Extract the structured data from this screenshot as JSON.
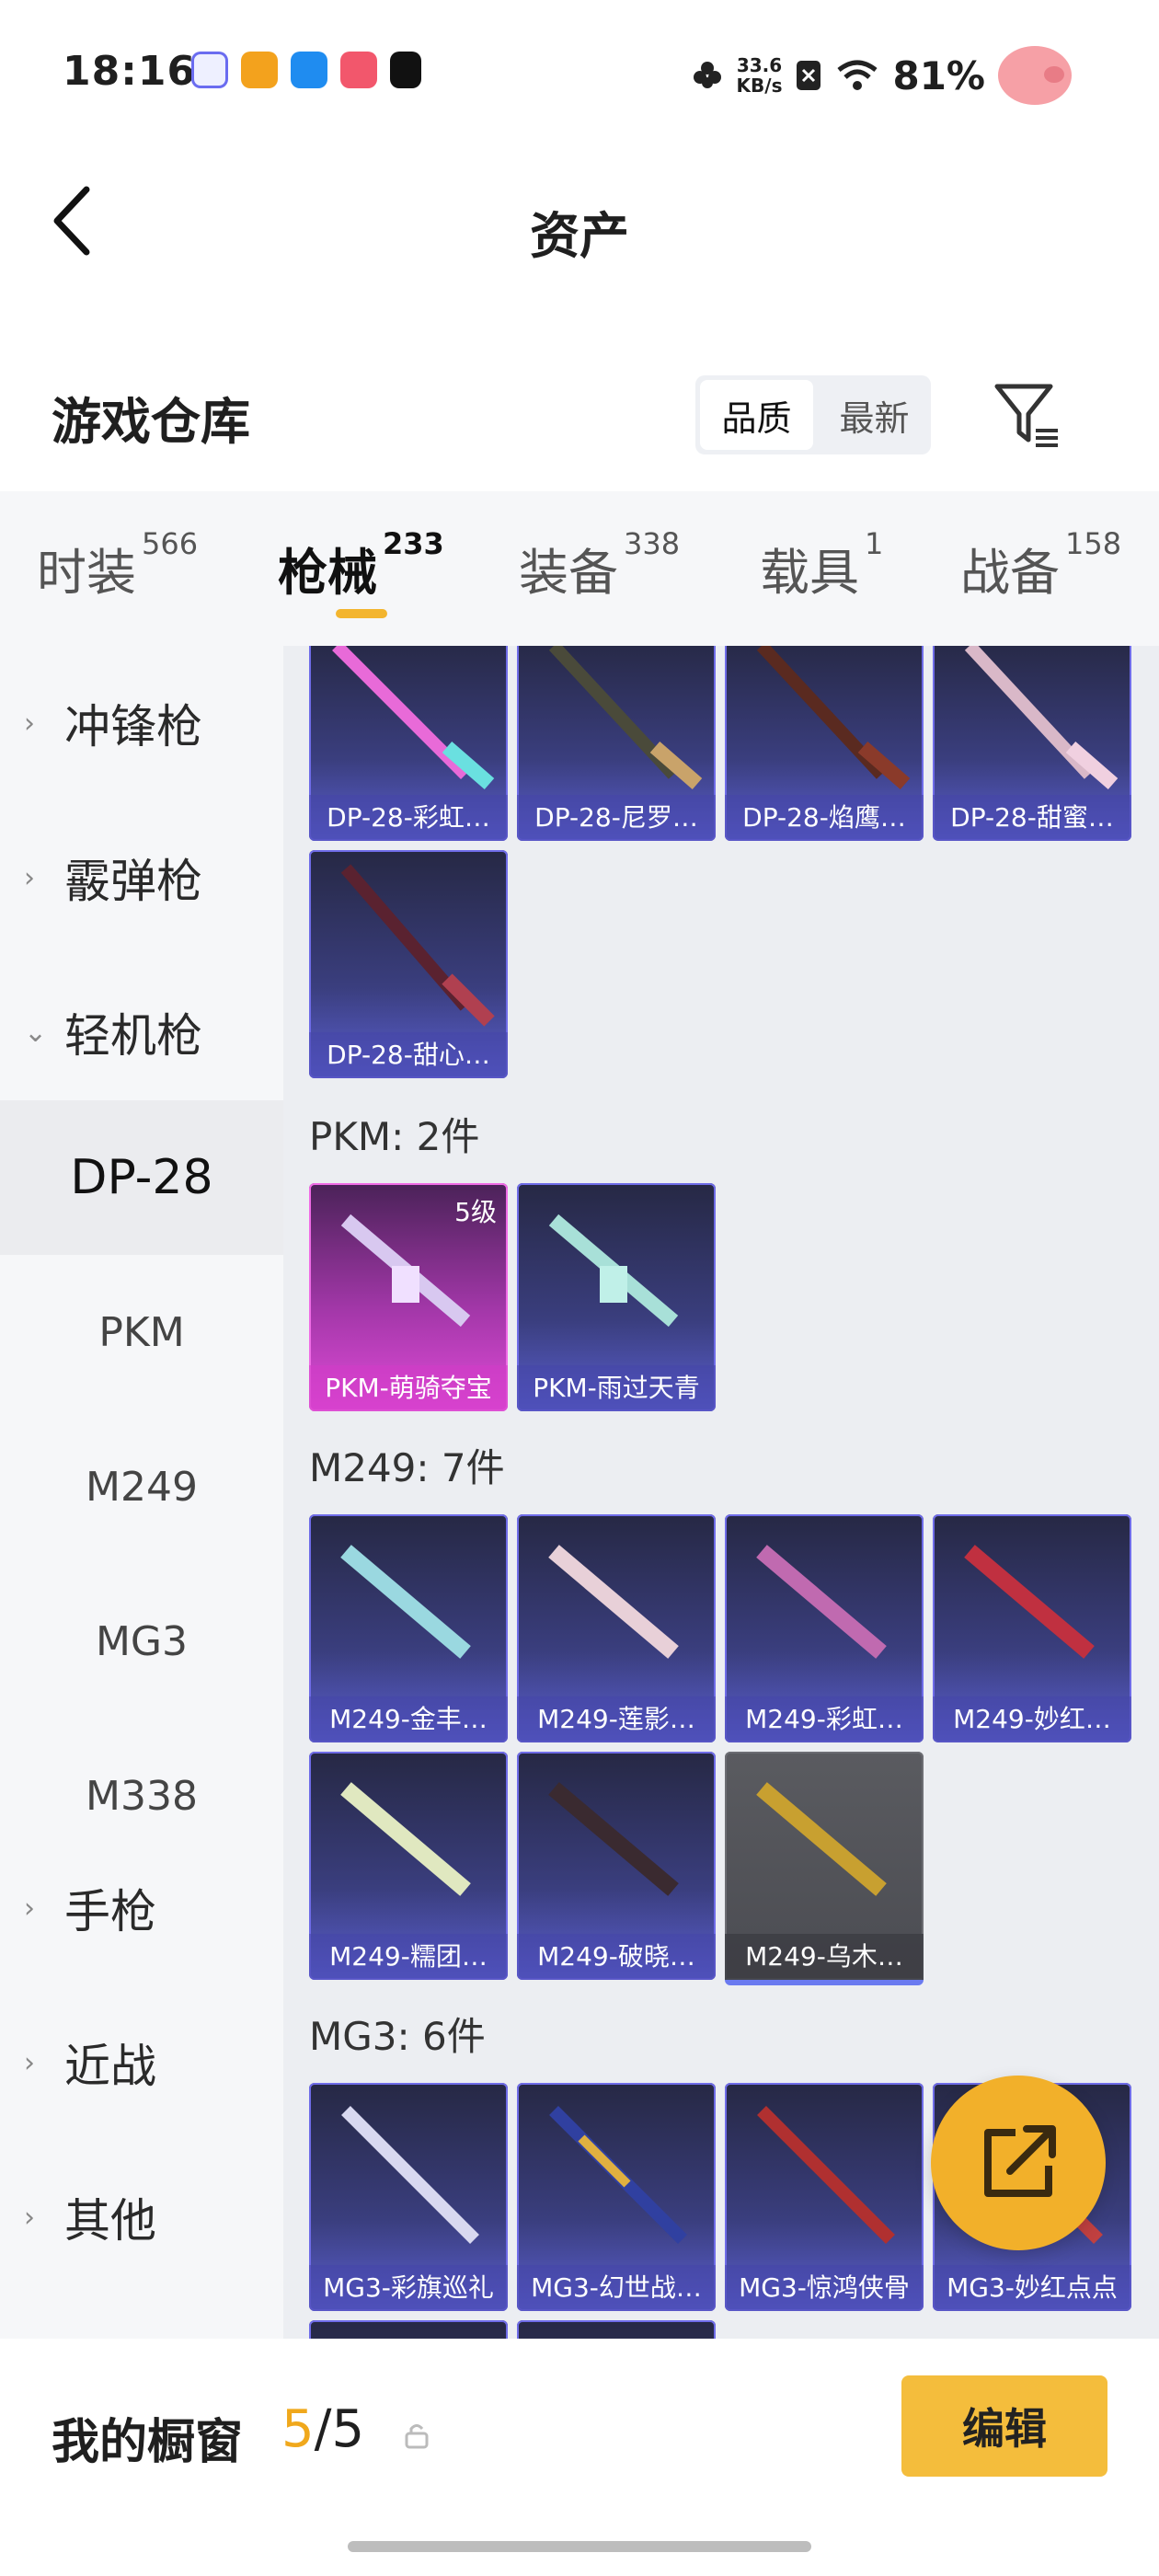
{
  "status": {
    "time": "18:16",
    "speed_top": "33.6",
    "speed_bottom": "KB/s",
    "battery": "81%"
  },
  "header": {
    "title": "资产"
  },
  "warehouse": {
    "title": "游戏仓库",
    "sort_quality": "品质",
    "sort_latest": "最新"
  },
  "tabs": [
    {
      "label": "时装",
      "count": "566"
    },
    {
      "label": "枪械",
      "count": "233"
    },
    {
      "label": "装备",
      "count": "338"
    },
    {
      "label": "载具",
      "count": "1"
    },
    {
      "label": "战备",
      "count": "158"
    }
  ],
  "sidebar": {
    "categories": [
      "冲锋枪",
      "霰弹枪",
      "轻机枪",
      "手枪",
      "近战",
      "其他"
    ],
    "subitems": [
      "DP-28",
      "PKM",
      "M249",
      "MG3",
      "M338"
    ]
  },
  "content": {
    "dp28_cards": [
      "DP-28-彩虹…",
      "DP-28-尼罗…",
      "DP-28-焰鹰…",
      "DP-28-甜蜜…",
      "DP-28-甜心…"
    ],
    "pkm_title": "PKM: 2件",
    "pkm_cards": [
      "PKM-萌骑夺宝",
      "PKM-雨过天青"
    ],
    "pkm_level": "5级",
    "m249_title": "M249: 7件",
    "m249_cards": [
      "M249-金丰…",
      "M249-莲影…",
      "M249-彩虹…",
      "M249-妙红…",
      "M249-糯团…",
      "M249-破晓…",
      "M249-乌木…"
    ],
    "mg3_title": "MG3: 6件",
    "mg3_cards": [
      "MG3-彩旗巡礼",
      "MG3-幻世战…",
      "MG3-惊鸿侠骨",
      "MG3-妙红点点"
    ]
  },
  "bottom": {
    "showcase": "我的橱窗",
    "count_current": "5",
    "count_total": "/5",
    "edit": "编辑"
  },
  "colors": {
    "accent": "#f3b52f",
    "card_blue": "#5b5fd0",
    "card_pink": "#e04bd8"
  }
}
